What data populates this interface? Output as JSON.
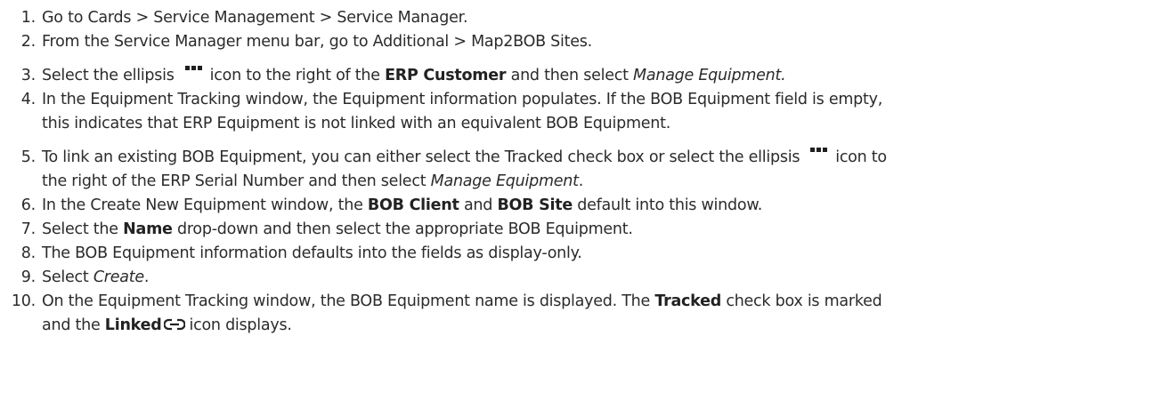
{
  "steps": [
    {
      "num": "1.",
      "text": "Go to Cards > Service Management > Service Manager."
    },
    {
      "num": "2.",
      "text": "From the Service Manager menu bar, go to Additional > Map2BOB Sites."
    },
    {
      "num": "3.",
      "pre": "Select the ellipsis",
      "mid": "icon to the right of the",
      "bold": "ERP Customer",
      "mid2": "and then select",
      "italic": "Manage Equipment."
    },
    {
      "num": "4.",
      "line1": "In the Equipment Tracking window, the Equipment information populates. If the BOB Equipment field is empty,",
      "line2": "this indicates that ERP Equipment is not linked with an equivalent BOB Equipment."
    },
    {
      "num": "5.",
      "line1_pre": "To link an existing BOB Equipment, you can either select the Tracked check box or select the ellipsis",
      "line1_post": "icon to",
      "line2_pre": "the right of the ERP Serial Number and then select",
      "italic": "Manage Equipment",
      "line2_post": "."
    },
    {
      "num": "6.",
      "pre": "In the Create New Equipment window, the",
      "bold1": "BOB Client",
      "mid": "and",
      "bold2": "BOB Site",
      "post": "default into this window."
    },
    {
      "num": "7.",
      "pre": "Select the",
      "bold": "Name",
      "post": "drop-down and then select the appropriate BOB Equipment."
    },
    {
      "num": "8.",
      "text": "The BOB Equipment information defaults into the fields as display-only."
    },
    {
      "num": "9.",
      "pre": "Select",
      "italic": "Create",
      "post": "."
    },
    {
      "num": "10.",
      "line1_pre": "On the Equipment Tracking window, the BOB Equipment name is displayed. The",
      "bold": "Tracked",
      "line1_post": "check box is marked",
      "line2_pre": "and the",
      "bold2": "Linked",
      "line2_post": "icon displays."
    }
  ],
  "icons": {
    "ellipsis": "ellipsis-icon",
    "linked": "linked-chain-icon"
  }
}
